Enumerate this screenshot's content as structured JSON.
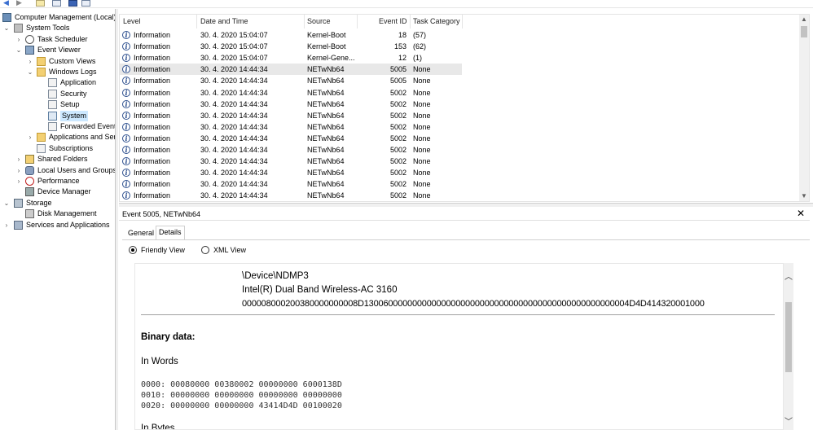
{
  "tree": {
    "items": [
      {
        "label": "Computer Management (Local)",
        "icon": "computer-icon",
        "caret": "",
        "level": 0
      },
      {
        "label": "System Tools",
        "icon": "tools-icon",
        "caret": "v",
        "level": 1
      },
      {
        "label": "Task Scheduler",
        "icon": "clock-icon",
        "caret": ">",
        "level": 2
      },
      {
        "label": "Event Viewer",
        "icon": "event-viewer-icon",
        "caret": "v",
        "level": 2
      },
      {
        "label": "Custom Views",
        "icon": "folder-icon",
        "caret": ">",
        "level": 3
      },
      {
        "label": "Windows Logs",
        "icon": "folder-icon",
        "caret": "v",
        "level": 3
      },
      {
        "label": "Application",
        "icon": "log-icon",
        "caret": "",
        "level": 4
      },
      {
        "label": "Security",
        "icon": "log-icon",
        "caret": "",
        "level": 4
      },
      {
        "label": "Setup",
        "icon": "log-icon",
        "caret": "",
        "level": 4
      },
      {
        "label": "System",
        "icon": "log-icon",
        "caret": "",
        "level": 4,
        "selected": true
      },
      {
        "label": "Forwarded Events",
        "icon": "log-icon",
        "caret": "",
        "level": 4
      },
      {
        "label": "Applications and Services Logs",
        "icon": "folder-icon",
        "caret": ">",
        "level": 3
      },
      {
        "label": "Subscriptions",
        "icon": "log-icon",
        "caret": "",
        "level": 3
      },
      {
        "label": "Shared Folders",
        "icon": "shared-folder-icon",
        "caret": ">",
        "level": 2
      },
      {
        "label": "Local Users and Groups",
        "icon": "users-icon",
        "caret": ">",
        "level": 2
      },
      {
        "label": "Performance",
        "icon": "performance-icon",
        "caret": ">",
        "level": 2
      },
      {
        "label": "Device Manager",
        "icon": "device-manager-icon",
        "caret": "",
        "level": 2
      },
      {
        "label": "Storage",
        "icon": "storage-icon",
        "caret": "v",
        "level": 1
      },
      {
        "label": "Disk Management",
        "icon": "disk-icon",
        "caret": "",
        "level": 2
      },
      {
        "label": "Services and Applications",
        "icon": "services-icon",
        "caret": ">",
        "level": 1
      }
    ]
  },
  "list": {
    "columns": [
      "Level",
      "Date and Time",
      "Source",
      "Event ID",
      "Task Category"
    ],
    "rows": [
      {
        "level": "Information",
        "datetime": "30. 4. 2020 15:04:07",
        "source": "Kernel-Boot",
        "event_id": "18",
        "category": "(57)"
      },
      {
        "level": "Information",
        "datetime": "30. 4. 2020 15:04:07",
        "source": "Kernel-Boot",
        "event_id": "153",
        "category": "(62)"
      },
      {
        "level": "Information",
        "datetime": "30. 4. 2020 15:04:07",
        "source": "Kernel-Gene...",
        "event_id": "12",
        "category": "(1)"
      },
      {
        "level": "Information",
        "datetime": "30. 4. 2020 14:44:34",
        "source": "NETwNb64",
        "event_id": "5005",
        "category": "None",
        "highlighted": true
      },
      {
        "level": "Information",
        "datetime": "30. 4. 2020 14:44:34",
        "source": "NETwNb64",
        "event_id": "5005",
        "category": "None"
      },
      {
        "level": "Information",
        "datetime": "30. 4. 2020 14:44:34",
        "source": "NETwNb64",
        "event_id": "5002",
        "category": "None"
      },
      {
        "level": "Information",
        "datetime": "30. 4. 2020 14:44:34",
        "source": "NETwNb64",
        "event_id": "5002",
        "category": "None"
      },
      {
        "level": "Information",
        "datetime": "30. 4. 2020 14:44:34",
        "source": "NETwNb64",
        "event_id": "5002",
        "category": "None"
      },
      {
        "level": "Information",
        "datetime": "30. 4. 2020 14:44:34",
        "source": "NETwNb64",
        "event_id": "5002",
        "category": "None"
      },
      {
        "level": "Information",
        "datetime": "30. 4. 2020 14:44:34",
        "source": "NETwNb64",
        "event_id": "5002",
        "category": "None"
      },
      {
        "level": "Information",
        "datetime": "30. 4. 2020 14:44:34",
        "source": "NETwNb64",
        "event_id": "5002",
        "category": "None"
      },
      {
        "level": "Information",
        "datetime": "30. 4. 2020 14:44:34",
        "source": "NETwNb64",
        "event_id": "5002",
        "category": "None"
      },
      {
        "level": "Information",
        "datetime": "30. 4. 2020 14:44:34",
        "source": "NETwNb64",
        "event_id": "5002",
        "category": "None"
      },
      {
        "level": "Information",
        "datetime": "30. 4. 2020 14:44:34",
        "source": "NETwNb64",
        "event_id": "5002",
        "category": "None"
      },
      {
        "level": "Information",
        "datetime": "30. 4. 2020 14:44:34",
        "source": "NETwNb64",
        "event_id": "5002",
        "category": "None"
      },
      {
        "level": "Information",
        "datetime": "30. 4. 2020 14:44:34",
        "source": "NETwNb64",
        "event_id": "5002",
        "category": "None"
      }
    ]
  },
  "detail": {
    "title": "Event 5005, NETwNb64",
    "close": "✕",
    "tabs": {
      "general": "General",
      "details": "Details"
    },
    "radio": {
      "friendly": "Friendly View",
      "xml": "XML View"
    },
    "lines": {
      "device": "\\Device\\NDMP3",
      "adapter": "Intel(R) Dual Band Wireless-AC 3160",
      "hex": "000008000200380000000008D1300600000000000000000000000000000000000000000000000004D4D414320001000",
      "binary_heading": "Binary data:",
      "in_words": "In Words",
      "words": [
        "0000: 00080000 00380002 00000000 6000138D",
        "0010: 00000000 00000000 00000000 00000000",
        "0020: 00000000 00000000 43414D4D 00100020"
      ],
      "in_bytes": "In Bytes"
    }
  }
}
